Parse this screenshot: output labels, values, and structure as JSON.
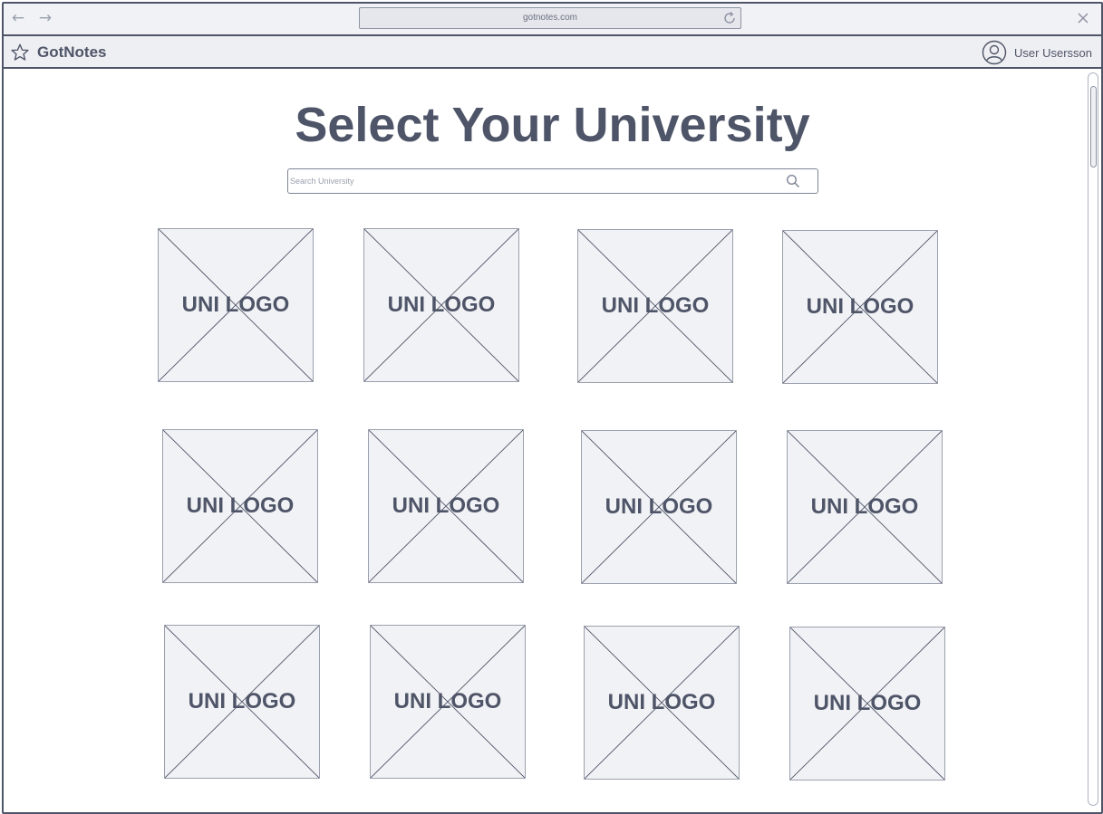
{
  "browser": {
    "url": "gotnotes.com",
    "back_icon": "arrow-left-icon",
    "forward_icon": "arrow-right-icon",
    "reload_icon": "reload-icon",
    "close_icon": "close-icon"
  },
  "header": {
    "app_name": "GotNotes",
    "logo_icon": "star-icon",
    "user_name": "User Usersson",
    "avatar_icon": "user-avatar-icon"
  },
  "main": {
    "title": "Select Your University",
    "search": {
      "placeholder": "Search University",
      "value": ""
    },
    "universities": [
      {
        "label": "UNI LOGO"
      },
      {
        "label": "UNI LOGO"
      },
      {
        "label": "UNI LOGO"
      },
      {
        "label": "UNI LOGO"
      },
      {
        "label": "UNI LOGO"
      },
      {
        "label": "UNI LOGO"
      },
      {
        "label": "UNI LOGO"
      },
      {
        "label": "UNI LOGO"
      },
      {
        "label": "UNI LOGO"
      },
      {
        "label": "UNI LOGO"
      },
      {
        "label": "UNI LOGO"
      },
      {
        "label": "UNI LOGO"
      }
    ]
  },
  "colors": {
    "ink": "#4f5568",
    "tile_fill": "#f1f2f5",
    "chrome": "#f1f2f5"
  }
}
